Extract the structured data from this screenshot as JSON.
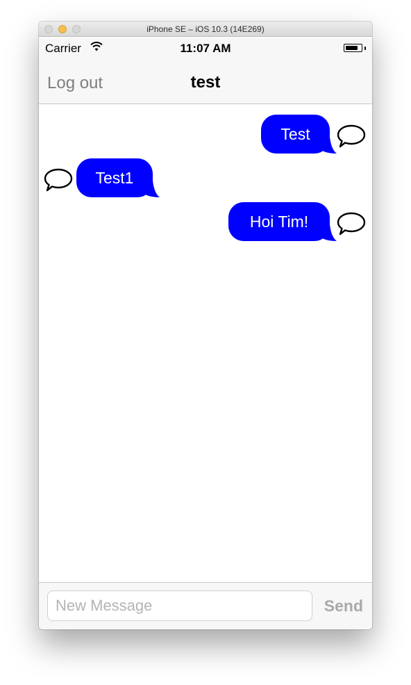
{
  "window": {
    "title": "iPhone SE – iOS 10.3 (14E269)"
  },
  "status_bar": {
    "carrier": "Carrier",
    "time": "11:07 AM",
    "wifi_icon": "wifi-icon",
    "battery_icon": "battery-icon"
  },
  "nav": {
    "left_button": "Log out",
    "title": "test"
  },
  "messages": [
    {
      "text": "Test",
      "side": "outgoing"
    },
    {
      "text": "Test1",
      "side": "incoming"
    },
    {
      "text": "Hoi Tim!",
      "side": "outgoing"
    }
  ],
  "composer": {
    "placeholder": "New Message",
    "value": "",
    "send_label": "Send"
  },
  "colors": {
    "bubble": "#0000ff",
    "bubble_text": "#ffffff",
    "nav_button": "#7f7f7f",
    "send_disabled": "#a9a9a9"
  }
}
